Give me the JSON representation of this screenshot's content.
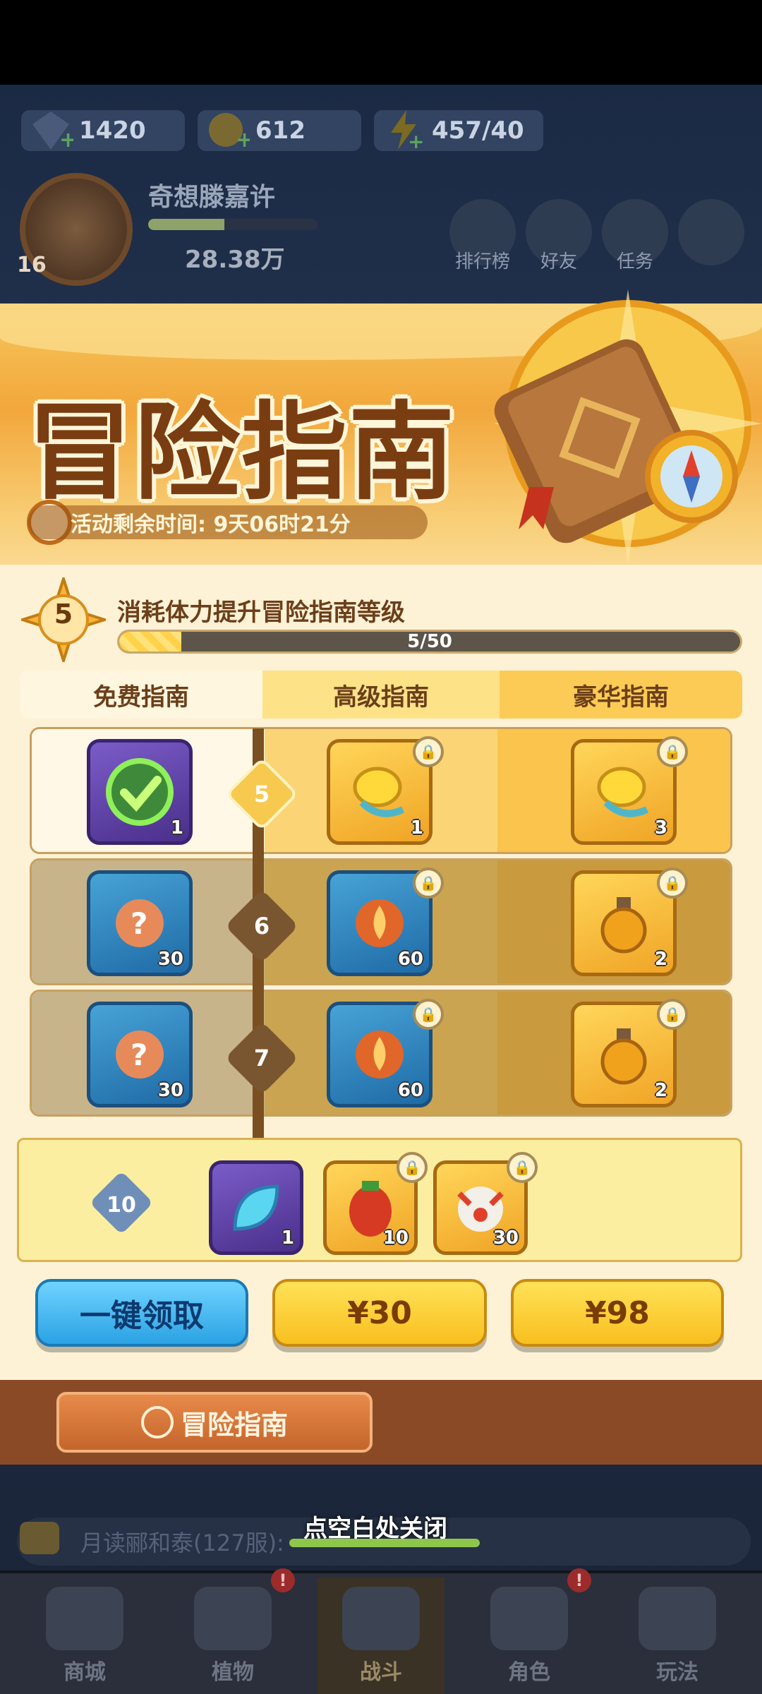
{
  "hud": {
    "gems": "1420",
    "coins": "612",
    "stamina": "457/40",
    "player_name": "奇想滕嘉许",
    "player_level": "16",
    "power": "28.38万",
    "top_buttons": [
      "排行榜",
      "好友",
      "任务"
    ]
  },
  "event": {
    "title": "冒险指南",
    "time_left_label": "活动剩余时间: 9天06时21分",
    "guide_level": "5",
    "level_hint": "消耗体力提升冒险指南等级",
    "progress_text": "5/50",
    "progress": 0.1
  },
  "tabs": [
    "免费指南",
    "高级指南",
    "豪华指南"
  ],
  "rows": [
    {
      "level": "5",
      "state": "claimed",
      "free": {
        "qty": "1",
        "icon": "claimed-check"
      },
      "premium": {
        "qty": "1",
        "icon": "golden-leaf"
      },
      "deluxe": {
        "qty": "3",
        "icon": "golden-leaf"
      }
    },
    {
      "level": "6",
      "state": "locked",
      "free": {
        "qty": "30",
        "icon": "mystery-seed"
      },
      "premium": {
        "qty": "60",
        "icon": "fire-seed"
      },
      "deluxe": {
        "qty": "2",
        "icon": "potion"
      }
    },
    {
      "level": "7",
      "state": "locked",
      "free": {
        "qty": "30",
        "icon": "mystery-seed"
      },
      "premium": {
        "qty": "60",
        "icon": "fire-seed"
      },
      "deluxe": {
        "qty": "2",
        "icon": "potion"
      }
    }
  ],
  "milestone": {
    "level": "10",
    "free": {
      "qty": "1",
      "icon": "crystal-leaf"
    },
    "premium": {
      "qty": "10",
      "icon": "pepper-hero"
    },
    "deluxe": {
      "qty": "30",
      "icon": "dragon-hero"
    }
  },
  "buttons": {
    "claim_all": "一键领取",
    "buy_premium": "¥30",
    "buy_deluxe": "¥98"
  },
  "footer_button": "冒险指南",
  "chat_text": "月读郦和泰(127服):",
  "close_hint": "点空白处关闭",
  "nav": [
    "商城",
    "植物",
    "战斗",
    "角色",
    "玩法"
  ],
  "nav_badges": [
    "!",
    "!"
  ]
}
